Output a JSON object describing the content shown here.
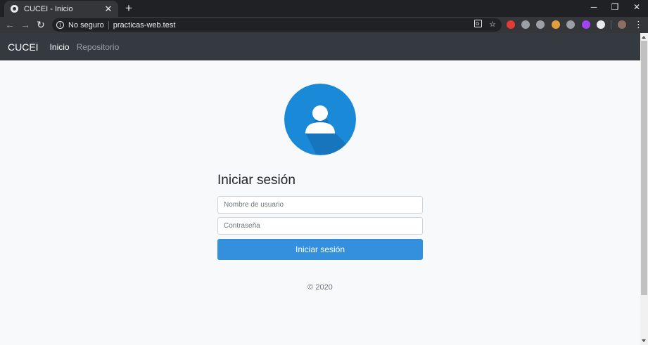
{
  "browser": {
    "tab_title": "CUCEI - Inicio",
    "tab_close": "✕",
    "new_tab": "+",
    "window_minimize": "─",
    "window_restore": "❐",
    "window_close": "✕",
    "back": "←",
    "forward": "→",
    "reload": "↻",
    "security_label": "No seguro",
    "url": "practicas-web.test",
    "translate_icon": "translate-icon",
    "star": "☆",
    "menu": "⋮",
    "extension_colors": [
      "#e53935",
      "#9aa0a6",
      "#9aa0a6",
      "#e0a040",
      "#9aa0a6",
      "#a142f4",
      "#e8eaed"
    ]
  },
  "site": {
    "brand": "CUCEI",
    "nav": {
      "home": "Inicio",
      "repo": "Repositorio"
    },
    "colors": {
      "navbar": "#343a40",
      "primary": "#3490dc",
      "avatar_blue": "#1a8ad8"
    }
  },
  "login": {
    "title": "Iniciar sesión",
    "username_placeholder": "Nombre de usuario",
    "password_placeholder": "Contraseña",
    "submit_label": "Iniciar sesión"
  },
  "footer": {
    "text": "© 2020"
  }
}
